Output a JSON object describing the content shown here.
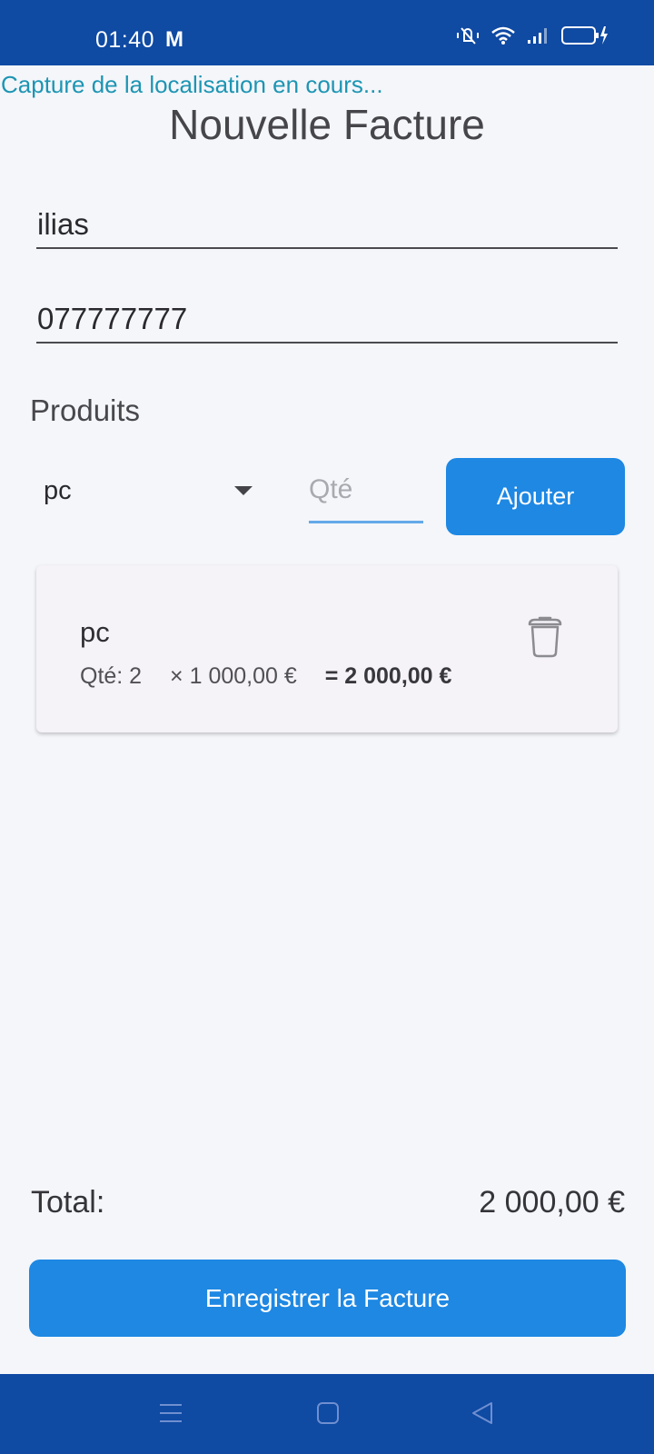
{
  "status_bar": {
    "time": "01:40",
    "mail_icon": "M",
    "icons": [
      "mute-vibrate-icon",
      "wifi-icon",
      "signal-icon",
      "battery-charging-icon"
    ]
  },
  "location_status": "Capture de la localisation en cours...",
  "title": "Nouvelle Facture",
  "form": {
    "client_name": "ilias",
    "client_phone": "077777777"
  },
  "products": {
    "section_title": "Produits",
    "selected_product": "pc",
    "quantity_value": "",
    "quantity_placeholder": "Qté",
    "add_label": "Ajouter"
  },
  "items": [
    {
      "name": "pc",
      "qty": "Qté: 2",
      "unit": "× 1 000,00 €",
      "total": "= 2 000,00 €"
    }
  ],
  "summary": {
    "total_label": "Total:",
    "total_value": "2 000,00 €"
  },
  "save_label": "Enregistrer la Facture",
  "colors": {
    "primary": "#1e88e3",
    "system_bar": "#0f4aa3",
    "background": "#f4f6fa",
    "card": "#f5f2f8",
    "status_text": "#1d95b3"
  }
}
